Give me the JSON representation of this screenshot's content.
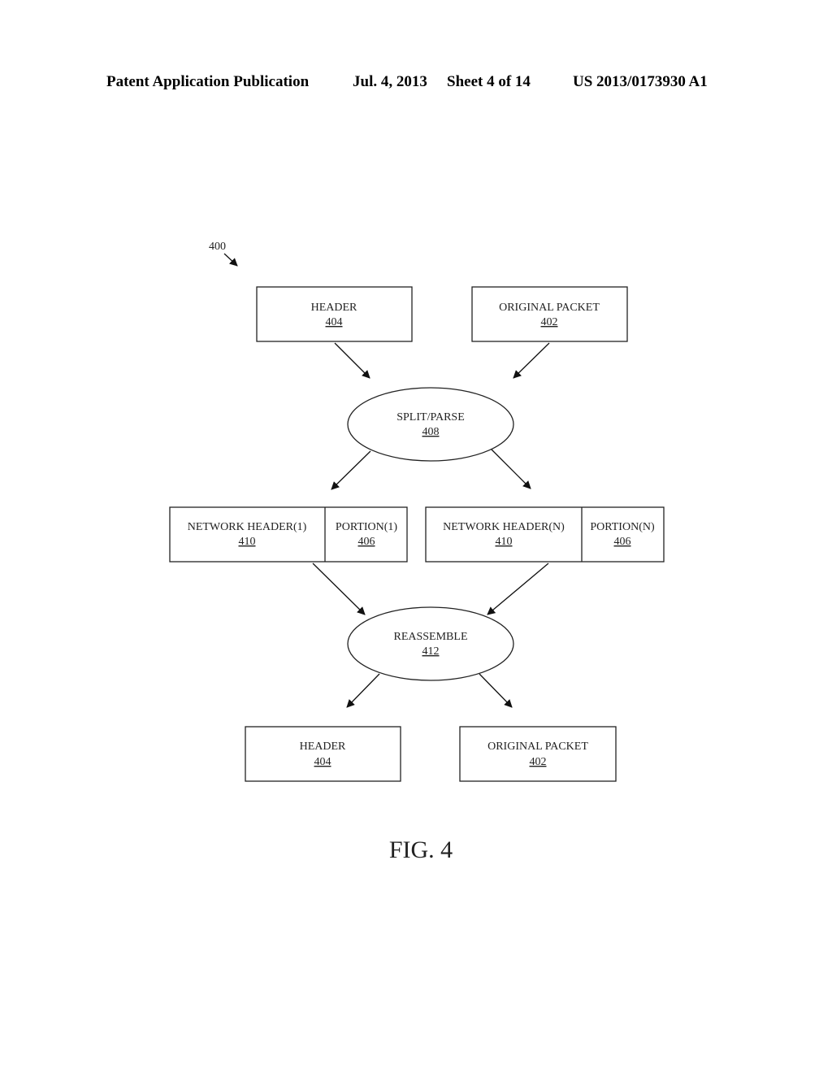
{
  "page_header": {
    "left": "Patent Application Publication",
    "date": "Jul. 4, 2013",
    "sheet": "Sheet 4 of 14",
    "number": "US 2013/0173930 A1"
  },
  "diagram": {
    "ref_label": "400",
    "nodes": {
      "header_top": {
        "title": "HEADER",
        "ref": "404"
      },
      "packet_top": {
        "title": "ORIGINAL PACKET",
        "ref": "402"
      },
      "split": {
        "title": "SPLIT/PARSE",
        "ref": "408"
      },
      "nh1": {
        "title": "NETWORK HEADER(1)",
        "ref": "410"
      },
      "p1": {
        "title": "PORTION(1)",
        "ref": "406"
      },
      "nhn": {
        "title": "NETWORK HEADER(N)",
        "ref": "410"
      },
      "pn": {
        "title": "PORTION(N)",
        "ref": "406"
      },
      "reassemble": {
        "title": "REASSEMBLE",
        "ref": "412"
      },
      "header_bottom": {
        "title": "HEADER",
        "ref": "404"
      },
      "packet_bottom": {
        "title": "ORIGINAL PACKET",
        "ref": "402"
      }
    },
    "caption": "FIG. 4"
  }
}
